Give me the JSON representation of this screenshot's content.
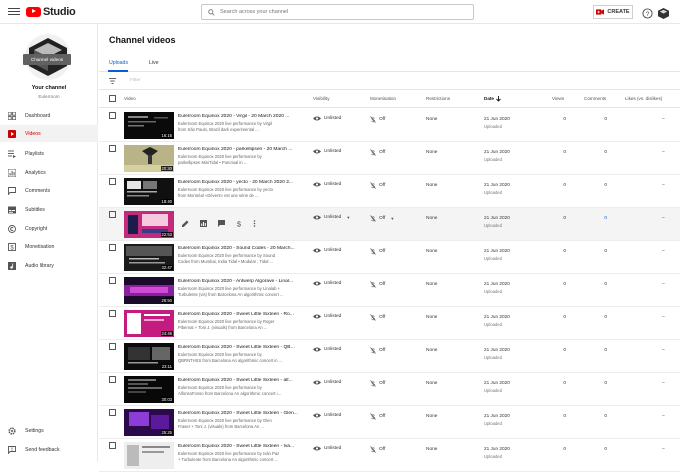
{
  "app": {
    "logo_text": "Studio"
  },
  "search": {
    "placeholder": "Search across your channel"
  },
  "header": {
    "create_label": "CREATE"
  },
  "sidebar": {
    "tooltip": "Channel videos",
    "channel_name": "Your channel",
    "channel_sub": "Eulerroom",
    "items": [
      {
        "label": "Dashboard",
        "icon": "dashboard-icon"
      },
      {
        "label": "Videos",
        "icon": "videos-icon"
      },
      {
        "label": "Playlists",
        "icon": "playlists-icon"
      },
      {
        "label": "Analytics",
        "icon": "analytics-icon"
      },
      {
        "label": "Comments",
        "icon": "comments-icon"
      },
      {
        "label": "Subtitles",
        "icon": "subtitles-icon"
      },
      {
        "label": "Copyright",
        "icon": "copyright-icon"
      },
      {
        "label": "Monetisation",
        "icon": "monetisation-icon"
      },
      {
        "label": "Audio library",
        "icon": "audio-library-icon"
      }
    ],
    "footer": [
      {
        "label": "Settings",
        "icon": "settings-icon"
      },
      {
        "label": "Send feedback",
        "icon": "feedback-icon"
      }
    ]
  },
  "main": {
    "title": "Channel videos",
    "tabs": [
      {
        "label": "Uploads"
      },
      {
        "label": "Live"
      }
    ],
    "filter_placeholder": "Filter",
    "columns": {
      "video": "Video",
      "visibility": "Visibility",
      "monetisation": "Monetisation",
      "restrictions": "Restrictions",
      "date": "Date",
      "views": "Views",
      "comments": "Comments",
      "likes": "Likes (vs. dislikes)"
    },
    "rows": [
      {
        "title": "Eulerroom Equinox 2020 - Virgil - 20 March 2020 ...",
        "desc1": "Eulerroom Equinox 2020 live performance by Virgil",
        "desc2": "from São Paulo, Brazil dark experimental ...",
        "duration": "16:16",
        "visibility": "Unlisted",
        "monetisation": "Off",
        "restrictions": "None",
        "date": "21 Jun 2020",
        "date_status": "Uploaded",
        "views": "0",
        "comments": "0",
        "likes": "–"
      },
      {
        "title": "Eulerroom Equinox 2020 - parkellipsen - 20 March ...",
        "desc1": "Eulerroom Equinox 2020 live performance by",
        "desc2": "parkellipsen MiniTidal • Punctual in ...",
        "duration": "20:30",
        "visibility": "Unlisted",
        "monetisation": "Off",
        "restrictions": "None",
        "date": "21 Jun 2020",
        "date_status": "Uploaded",
        "views": "0",
        "comments": "0",
        "likes": "–"
      },
      {
        "title": "Eulerroom Equinox 2020 - yecto - 20 March 2020 2...",
        "desc1": "Eulerroom Equinox 2020 live performance by yecto",
        "desc2": "from Montréal «Dévent» est une série de ...",
        "duration": "18:40",
        "visibility": "Unlisted",
        "monetisation": "Off",
        "restrictions": "None",
        "date": "21 Jun 2020",
        "date_status": "Uploaded",
        "views": "0",
        "comments": "0",
        "likes": "–"
      },
      {
        "title": "",
        "desc1": "",
        "desc2": "",
        "duration": "22:53",
        "visibility": "Unlisted",
        "monetisation": "Off",
        "restrictions": "None",
        "date": "21 Jun 2020",
        "date_status": "Uploaded",
        "views": "0",
        "comments": "0",
        "likes": "–"
      },
      {
        "title": "Eulerroom Equinox 2020 - Sound Codes - 20 March...",
        "desc1": "Eulerroom Equinox 2020 live performance by Sound",
        "desc2": "Codes from Mumbai, India Tidal • Modular : Tidal ...",
        "duration": "32:47",
        "visibility": "Unlisted",
        "monetisation": "Off",
        "restrictions": "None",
        "date": "21 Jun 2020",
        "date_status": "Uploaded",
        "views": "0",
        "comments": "0",
        "likes": "–"
      },
      {
        "title": "Eulerroom Equinox 2020 - Antwerp Algorave - Linal...",
        "desc1": "Eulerroom Equinox 2020 live performance by Linalab +",
        "desc2": "Turbulente (vis) from Barcelona An algorithmic concert ...",
        "duration": "28:50",
        "visibility": "Unlisted",
        "monetisation": "Off",
        "restrictions": "None",
        "date": "21 Jun 2020",
        "date_status": "Uploaded",
        "views": "0",
        "comments": "0",
        "likes": "–"
      },
      {
        "title": "Eulerroom Equinox 2020 - Sweet Little Sixteen - Ro...",
        "desc1": "Eulerroom Equinox 2020 live performance by Roger",
        "desc2": "Pibernat + Toni J. (visuals) from Barcelona An ...",
        "duration": "24:46",
        "visibility": "Unlisted",
        "monetisation": "Off",
        "restrictions": "None",
        "date": "21 Jun 2020",
        "date_status": "Uploaded",
        "views": "0",
        "comments": "0",
        "likes": "–"
      },
      {
        "title": "Eulerroom Equinox 2020 - Sweet Little Sixteen - QBR...",
        "desc1": "Eulerroom Equinox 2020 live performance by",
        "desc2": "QBRNTHSS from Barcelona An algorithmic concert in ...",
        "duration": "23:11",
        "visibility": "Unlisted",
        "monetisation": "Off",
        "restrictions": "None",
        "date": "21 Jun 2020",
        "date_status": "Uploaded",
        "views": "0",
        "comments": "0",
        "likes": "–"
      },
      {
        "title": "Eulerroom Equinox 2020 - Sweet Little Sixteen - alf...",
        "desc1": "Eulerroom Equinox 2020 live performance by",
        "desc2": "AlfonsoFonso from Barcelona An algorithmic concert i...",
        "duration": "30:03",
        "visibility": "Unlisted",
        "monetisation": "Off",
        "restrictions": "None",
        "date": "21 Jun 2020",
        "date_status": "Uploaded",
        "views": "0",
        "comments": "0",
        "likes": "–"
      },
      {
        "title": "Eulerroom Equinox 2020 - Sweet Little Sixteen - Glen...",
        "desc1": "Eulerroom Equinox 2020 live performance by Glen",
        "desc2": "Fraser + Toni J. (visuals) from Barcelona An ...",
        "duration": "25:25",
        "visibility": "Unlisted",
        "monetisation": "Off",
        "restrictions": "None",
        "date": "21 Jun 2020",
        "date_status": "Uploaded",
        "views": "0",
        "comments": "0",
        "likes": "–"
      },
      {
        "title": "Eulerroom Equinox 2020 - Sweet Little Sixteen - Ivá...",
        "desc1": "Eulerroom Equinox 2020 live performance by Iván Paz",
        "desc2": "+ Turbulente from Barcelona An algorithmic concert ...",
        "duration": "",
        "visibility": "Unlisted",
        "monetisation": "Off",
        "restrictions": "None",
        "date": "21 Jun 2020",
        "date_status": "Uploaded",
        "views": "0",
        "comments": "0",
        "likes": "–"
      }
    ],
    "hover_row_comments": "0"
  },
  "colors": {
    "brand_red": "#ff0000",
    "accent_blue": "#065fd4",
    "active_red": "#cc0000"
  }
}
